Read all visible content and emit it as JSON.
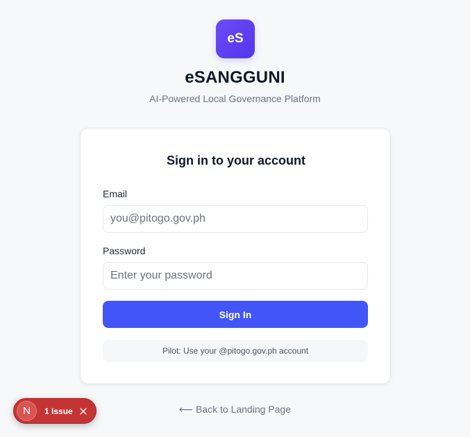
{
  "brand": {
    "logo_text": "eS",
    "title": "eSANGGUNI",
    "subtitle": "AI-Powered Local Governance Platform"
  },
  "login_card": {
    "title": "Sign in to your account",
    "email": {
      "label": "Email",
      "value": "",
      "placeholder": "you@pitogo.gov.ph"
    },
    "password": {
      "label": "Password",
      "value": "",
      "placeholder": "Enter your password"
    },
    "submit_label": "Sign In",
    "pilot_note": "Pilot: Use your @pitogo.gov.ph account"
  },
  "back_link": {
    "arrow": "⟵",
    "label": "Back to Landing Page"
  },
  "dev_overlay": {
    "logo_letter": "N",
    "issue_label": "1 Issue",
    "icons": [
      "nextjs-logo-icon",
      "close-icon"
    ]
  },
  "colors": {
    "background": "#f7f8fa",
    "brand_purple": "#5436ee",
    "primary_button": "#4255f7",
    "issue_badge": "#c53434"
  }
}
